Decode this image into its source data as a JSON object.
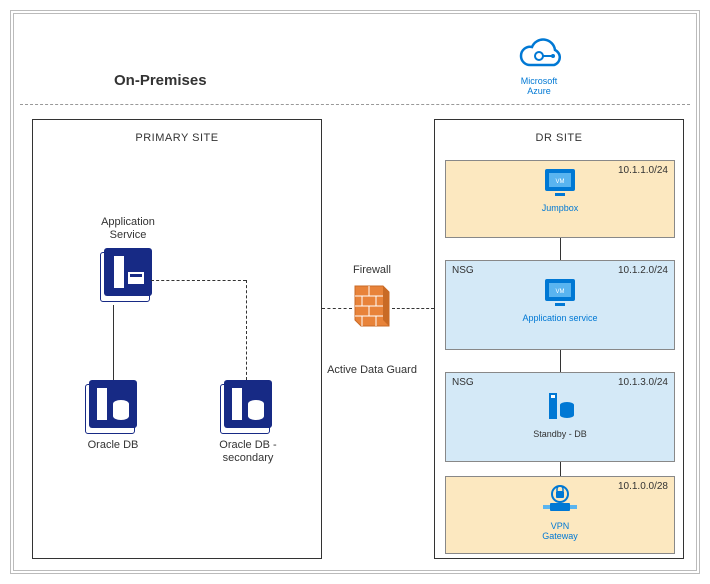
{
  "header": {
    "onprem": "On-Premises",
    "azure": "Microsoft\nAzure"
  },
  "primary": {
    "title": "PRIMARY SITE",
    "app": "Application\nService",
    "db1": "Oracle DB",
    "db2": "Oracle DB -\nsecondary"
  },
  "firewall": {
    "label": "Firewall",
    "bottom": "Active Data Guard"
  },
  "dr": {
    "title": "DR SITE",
    "subnets": [
      {
        "nsg": "",
        "cidr": "10.1.1.0/24",
        "label": "Jumpbox",
        "type": "vm"
      },
      {
        "nsg": "NSG",
        "cidr": "10.1.2.0/24",
        "label": "Application service",
        "type": "vm"
      },
      {
        "nsg": "NSG",
        "cidr": "10.1.3.0/24",
        "label": "Standby - DB",
        "type": "db"
      },
      {
        "nsg": "",
        "cidr": "10.1.0.0/28",
        "label": "VPN\nGateway",
        "type": "vpn"
      }
    ]
  }
}
